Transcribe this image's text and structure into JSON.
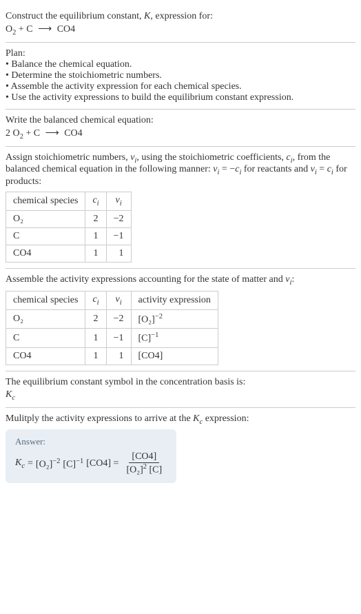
{
  "intro": {
    "line1": "Construct the equilibrium constant, ",
    "K": "K",
    "line1_end": ", expression for:",
    "equation_left": "O",
    "equation_O2_sub": "2",
    "equation_plus": " + C ",
    "equation_arrow": "⟶",
    "equation_right": " CO4"
  },
  "plan": {
    "heading": "Plan:",
    "items": [
      "Balance the chemical equation.",
      "Determine the stoichiometric numbers.",
      "Assemble the activity expression for each chemical species.",
      "Use the activity expressions to build the equilibrium constant expression."
    ]
  },
  "balanced": {
    "heading": "Write the balanced chemical equation:",
    "eq_pre": "2 O",
    "eq_O2_sub": "2",
    "eq_mid": " + C ",
    "eq_arrow": "⟶",
    "eq_end": " CO4"
  },
  "assign": {
    "text1": "Assign stoichiometric numbers, ",
    "nu": "ν",
    "i_sub": "i",
    "text2": ", using the stoichiometric coefficients, ",
    "c": "c",
    "text3": ", from the balanced chemical equation in the following manner: ",
    "eq_react": " = −",
    "text4": " for reactants and ",
    "eq_prod": " = ",
    "text5": " for products:",
    "table": {
      "headers": [
        "chemical species",
        "cᵢ",
        "νᵢ"
      ],
      "rows": [
        {
          "species": "O₂",
          "c": "2",
          "nu": "−2"
        },
        {
          "species": "C",
          "c": "1",
          "nu": "−1"
        },
        {
          "species": "CO4",
          "c": "1",
          "nu": "1"
        }
      ]
    }
  },
  "assemble": {
    "text1": "Assemble the activity expressions accounting for the state of matter and ",
    "text2": ":",
    "table": {
      "headers": [
        "chemical species",
        "cᵢ",
        "νᵢ",
        "activity expression"
      ],
      "rows": [
        {
          "species": "O₂",
          "c": "2",
          "nu": "−2",
          "expr_base": "[O₂]",
          "expr_exp": "−2"
        },
        {
          "species": "C",
          "c": "1",
          "nu": "−1",
          "expr_base": "[C]",
          "expr_exp": "−1"
        },
        {
          "species": "CO4",
          "c": "1",
          "nu": "1",
          "expr_base": "[CO4]",
          "expr_exp": ""
        }
      ]
    }
  },
  "symbol": {
    "text": "The equilibrium constant symbol in the concentration basis is:",
    "K": "K",
    "c_sub": "c"
  },
  "multiply": {
    "text1": "Mulitply the activity expressions to arrive at the ",
    "K": "K",
    "c_sub": "c",
    "text2": " expression:"
  },
  "answer": {
    "label": "Answer:",
    "Kc_K": "K",
    "Kc_c": "c",
    "equals": " = ",
    "term1_base": "[O₂]",
    "term1_exp": "−2",
    "term2_base": " [C]",
    "term2_exp": "−1",
    "term3": " [CO4] = ",
    "frac_num": "[CO4]",
    "frac_den_1": "[O₂]",
    "frac_den_1_exp": "2",
    "frac_den_2": " [C]"
  }
}
